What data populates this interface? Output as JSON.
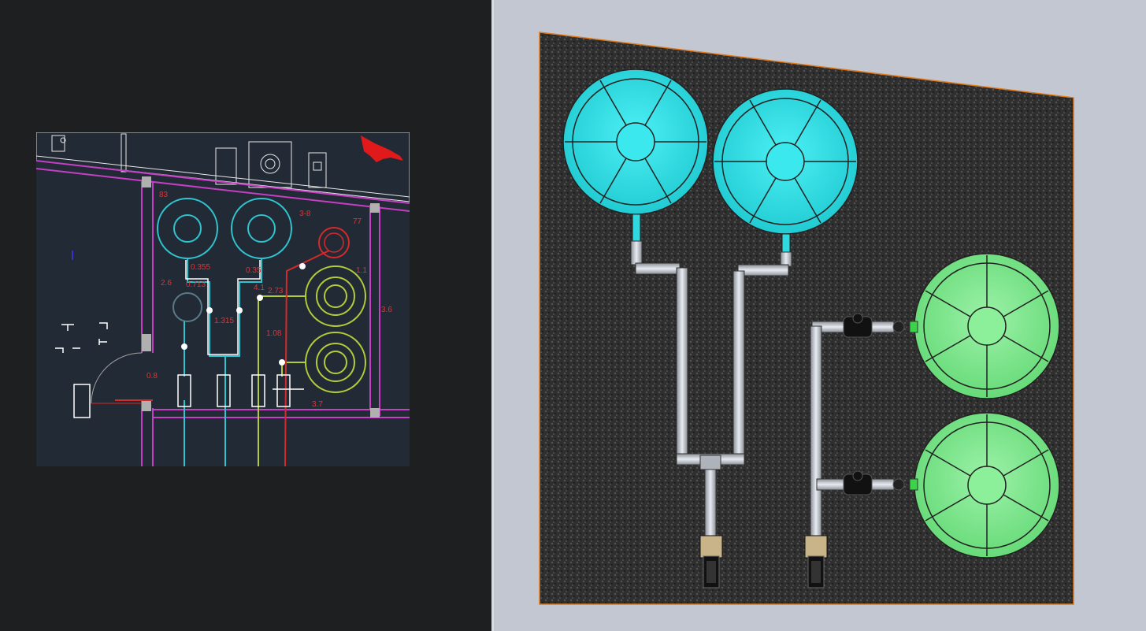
{
  "cad_drawing": {
    "annotations": [
      "83",
      "3-8",
      "77",
      "2.6",
      "0.355",
      "0.35",
      "1.1",
      "4.1",
      "0.713",
      "2.73",
      "1.315",
      "3.6",
      "1.08",
      "0.8",
      "3.7"
    ]
  },
  "model_view": {
    "tanks": [
      {
        "name": "cyan-tank-1",
        "color": "#2ee2e8"
      },
      {
        "name": "cyan-tank-2",
        "color": "#2ee2e8"
      },
      {
        "name": "green-tank-1",
        "color": "#7ee88e"
      },
      {
        "name": "green-tank-2",
        "color": "#7ee88e"
      }
    ],
    "pumps": 2,
    "valves": 2
  },
  "colors": {
    "cad_background": "#222a35",
    "wall": "#c43fc4",
    "pipe_cyan": "#2fc4cf",
    "pipe_green": "#b4cc3a",
    "pipe_red": "#d42a2a",
    "model_ground": "#2f2f2f",
    "model_border": "#e07a1a",
    "viewport_bg": "#c3c7d1"
  }
}
